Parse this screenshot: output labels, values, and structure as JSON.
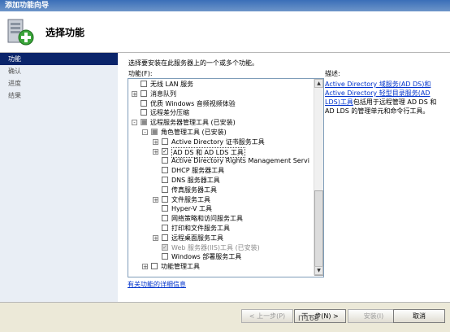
{
  "window": {
    "title": "添加功能向导"
  },
  "header": {
    "title": "选择功能"
  },
  "nav": {
    "items": [
      {
        "label": "功能",
        "active": true
      },
      {
        "label": "确认",
        "active": false
      },
      {
        "label": "进度",
        "active": false
      },
      {
        "label": "结果",
        "active": false
      }
    ]
  },
  "main": {
    "instruction": "选择要安装在此服务器上的一个或多个功能。",
    "list_label": "功能(F):",
    "desc_label": "描述:",
    "description": {
      "link": "Active Directory 域服务(AD DS)和 Active Directory 轻型目录服务(AD LDS)工具",
      "text": "包括用于远程管理 AD DS 和 AD LDS 的管理单元和命令行工具。"
    },
    "more_link": "有关功能的详细信息"
  },
  "tree": [
    {
      "label": "无线 LAN 服务",
      "level": 0,
      "expander": "",
      "check": ""
    },
    {
      "label": "消息队列",
      "level": 0,
      "expander": "+",
      "check": ""
    },
    {
      "label": "优质 Windows 音频视频体验",
      "level": 0,
      "expander": "",
      "check": ""
    },
    {
      "label": "远程差分压缩",
      "level": 0,
      "expander": "",
      "check": ""
    },
    {
      "label": "远程服务器管理工具    (已安装)",
      "level": 0,
      "expander": "-",
      "check": "gray"
    },
    {
      "label": "角色管理工具    (已安装)",
      "level": 1,
      "expander": "-",
      "check": "gray"
    },
    {
      "label": "Active Directory 证书服务工具",
      "level": 2,
      "expander": "+",
      "check": ""
    },
    {
      "label": "AD DS 和 AD LDS 工具",
      "level": 2,
      "expander": "+",
      "check": "checked",
      "selected": true
    },
    {
      "label": "Active Directory Rights Management Servi",
      "level": 2,
      "expander": "",
      "check": ""
    },
    {
      "label": "DHCP 服务器工具",
      "level": 2,
      "expander": "",
      "check": ""
    },
    {
      "label": "DNS 服务器工具",
      "level": 2,
      "expander": "",
      "check": ""
    },
    {
      "label": "传真服务器工具",
      "level": 2,
      "expander": "",
      "check": ""
    },
    {
      "label": "文件服务工具",
      "level": 2,
      "expander": "+",
      "check": ""
    },
    {
      "label": "Hyper-V 工具",
      "level": 2,
      "expander": "",
      "check": ""
    },
    {
      "label": "网络策略和访问服务工具",
      "level": 2,
      "expander": "",
      "check": ""
    },
    {
      "label": "打印和文件服务工具",
      "level": 2,
      "expander": "",
      "check": ""
    },
    {
      "label": "远程桌面服务工具",
      "level": 2,
      "expander": "+",
      "check": ""
    },
    {
      "label": "Web 服务器(IIS)工具    (已安装)",
      "level": 2,
      "expander": "",
      "check": "graycheck",
      "dim": true
    },
    {
      "label": "Windows 部署服务工具",
      "level": 2,
      "expander": "",
      "check": ""
    },
    {
      "label": "功能管理工具",
      "level": 1,
      "expander": "+",
      "check": ""
    }
  ],
  "buttons": {
    "prev": "< 上一步(P)",
    "next": "下一步(N) >",
    "install": "安装(I)",
    "cancel": "取消"
  },
  "watermark": "IT168"
}
